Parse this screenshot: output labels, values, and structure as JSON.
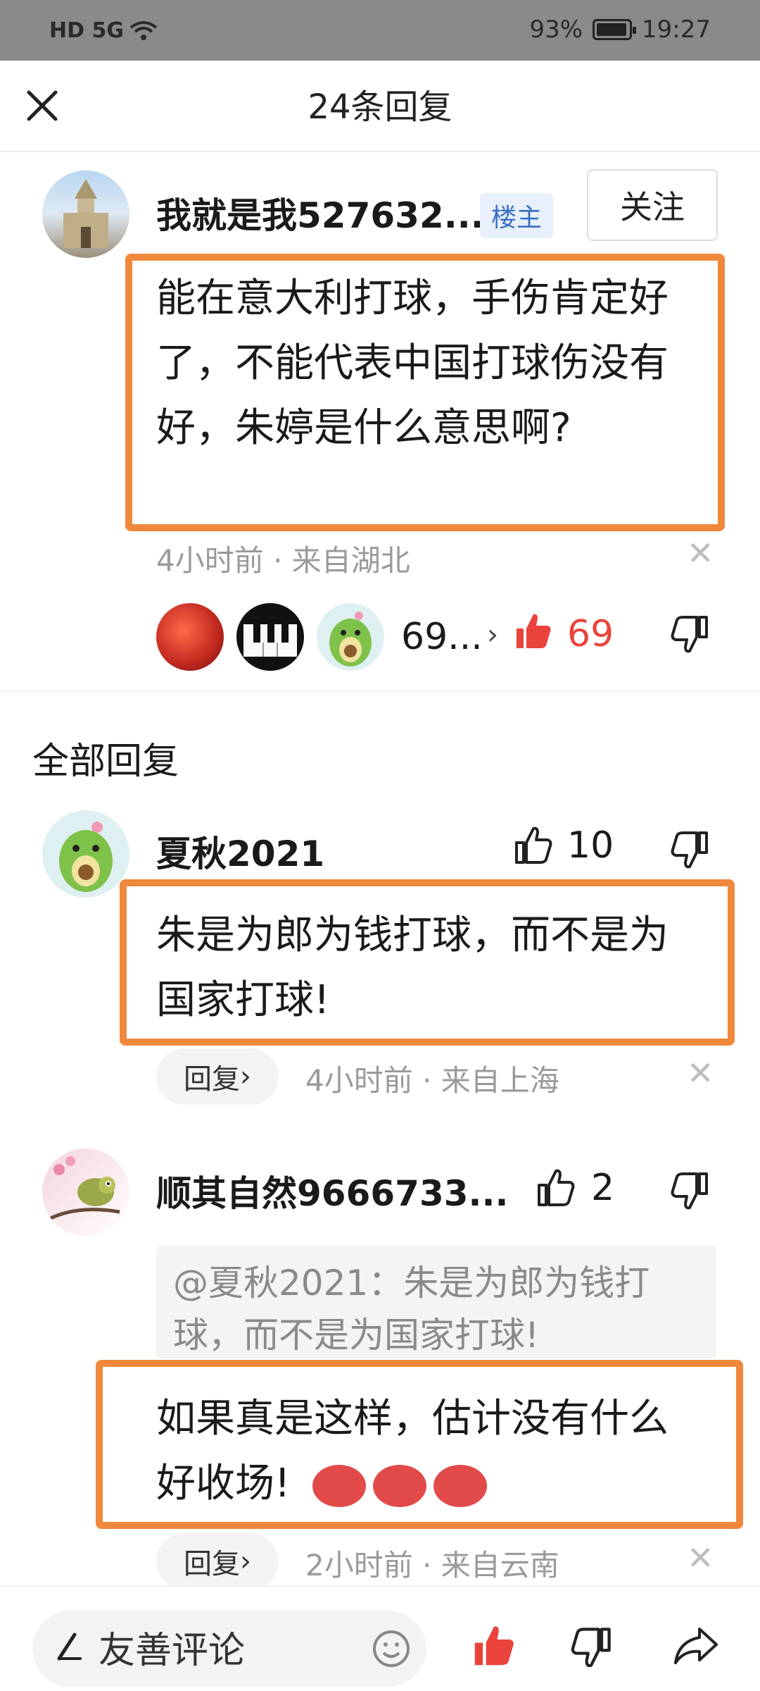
{
  "status": {
    "network": "HD 5G",
    "battery": "93%",
    "time": "19:27"
  },
  "header": {
    "title": "24条回复",
    "close_icon": "close-icon"
  },
  "op": {
    "name": "我就是我527632...",
    "badge": "楼主",
    "follow_label": "关注",
    "text": "能在意大利打球，手伤肯定好了，不能代表中国打球伤没有好，朱婷是什么意思啊?",
    "meta": "4小时前 · 来自湖北",
    "likers_count": "69...",
    "likes": "69"
  },
  "all_replies_label": "全部回复",
  "replies": [
    {
      "name": "夏秋2021",
      "likes": "10",
      "text": "朱是为郎为钱打球，而不是为国家打球!",
      "reply_label": "回复",
      "meta": "4小时前 · 来自上海"
    },
    {
      "name": "顺其自然9666733...",
      "likes": "2",
      "quote": "@夏秋2021：朱是为郎为钱打球，而不是为国家打球!",
      "text": "如果真是这样，估计没有什么好收场!",
      "reply_label": "回复",
      "meta": "2小时前 · 来自云南"
    }
  ],
  "bottom": {
    "input_placeholder": "友善评论"
  },
  "colors": {
    "highlight": "#f0883c",
    "like_red": "#e9433b",
    "badge_blue": "#3a6fc4"
  }
}
